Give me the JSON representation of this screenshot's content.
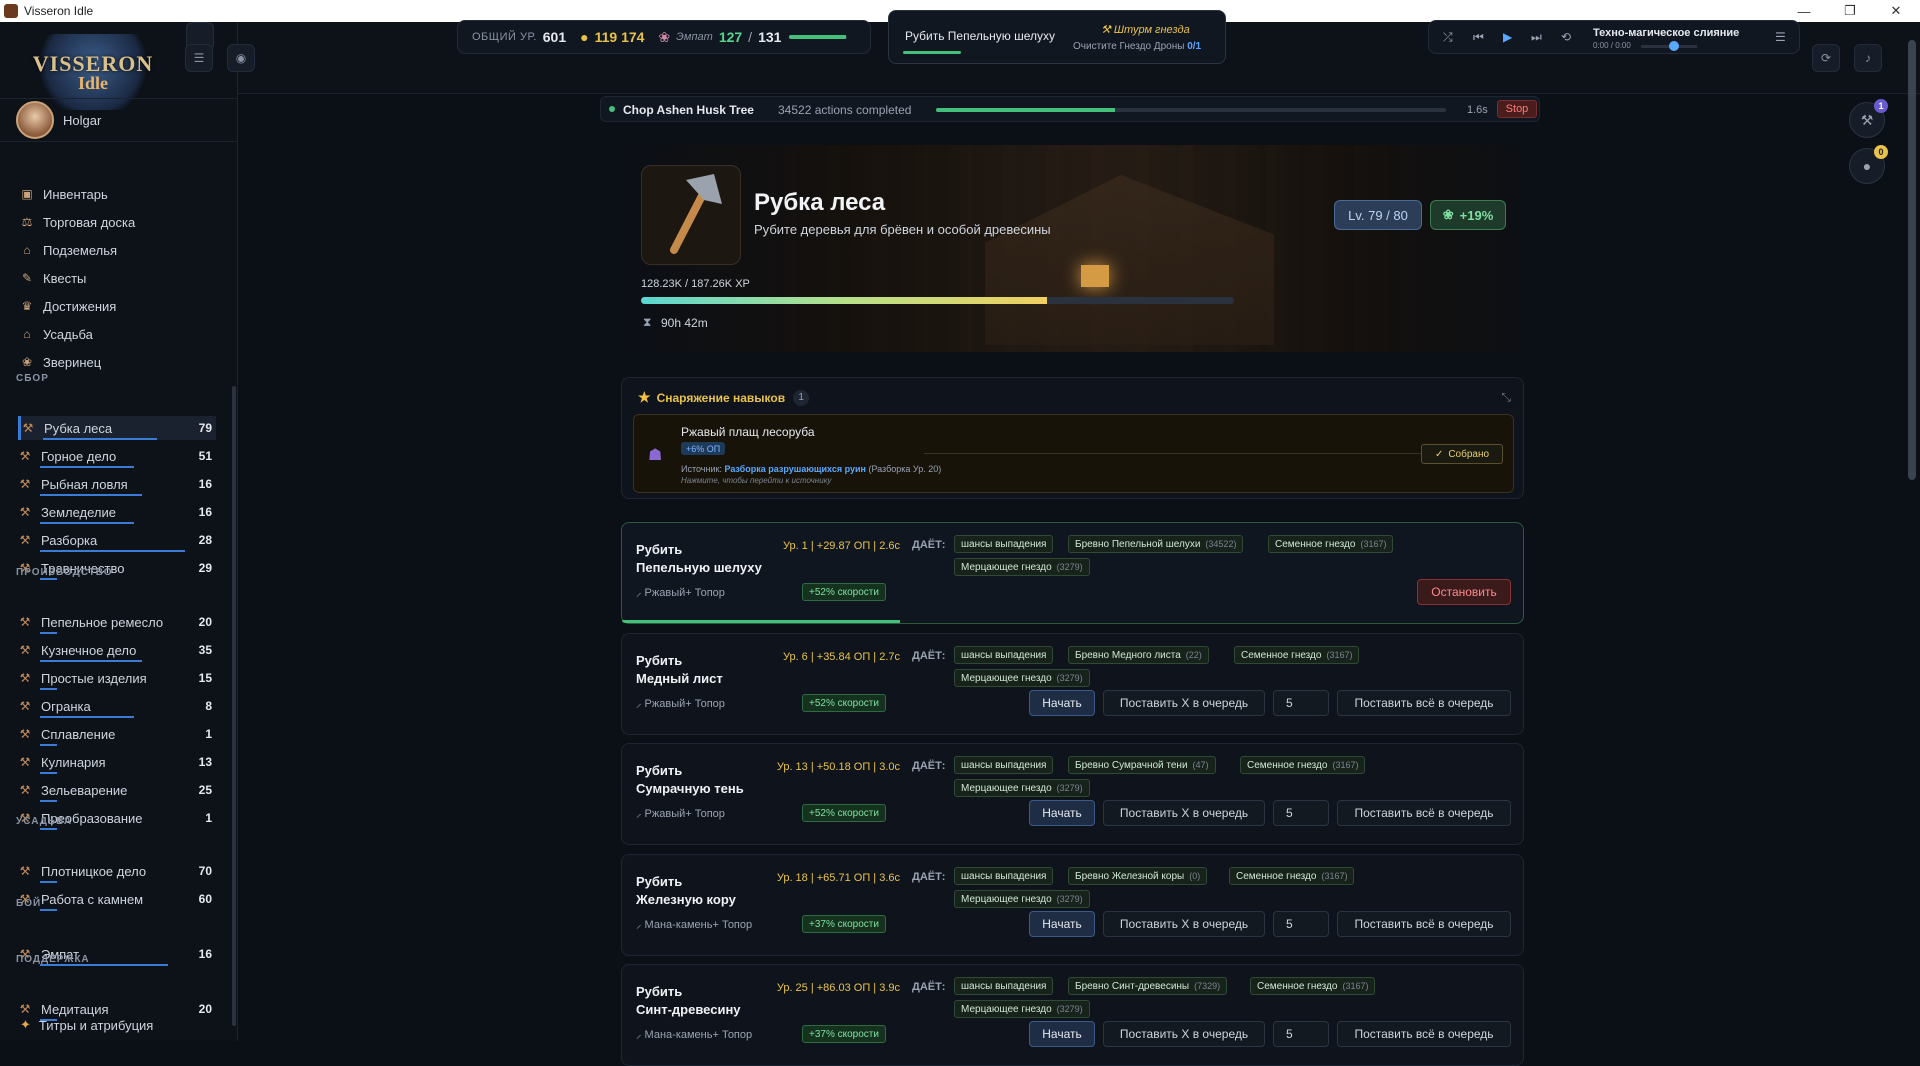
{
  "window": {
    "title": "Visseron Idle",
    "min": "—",
    "max": "❐",
    "close": "✕"
  },
  "logo": {
    "line1": "VISSERON",
    "line2": "Idle"
  },
  "user": {
    "name": "Holgar"
  },
  "nav": [
    {
      "label": "Инвентарь",
      "icon": "backpack-icon",
      "glyph": "▣"
    },
    {
      "label": "Торговая доска",
      "icon": "scale-icon",
      "glyph": "⚖"
    },
    {
      "label": "Подземелья",
      "icon": "dungeon-icon",
      "glyph": "⌂"
    },
    {
      "label": "Квесты",
      "icon": "scroll-icon",
      "glyph": "✎"
    },
    {
      "label": "Достижения",
      "icon": "trophy-icon",
      "glyph": "♛"
    },
    {
      "label": "Усадьба",
      "icon": "house-icon",
      "glyph": "⌂"
    },
    {
      "label": "Зверинец",
      "icon": "paw-icon",
      "glyph": "❀"
    }
  ],
  "sections": {
    "gather": "СБОР",
    "produce": "ПРОИЗВОДСТВО",
    "manor": "УСАДЬБА",
    "combat": "БОЙ",
    "support": "ПОДДЕРЖКА"
  },
  "skills_gather": [
    {
      "label": "Рубка леса",
      "lv": "79",
      "progress": 0.67
    },
    {
      "label": "Горное дело",
      "lv": "51",
      "progress": 0.55
    },
    {
      "label": "Рыбная ловля",
      "lv": "16",
      "progress": 0.6
    },
    {
      "label": "Земледелие",
      "lv": "16",
      "progress": 0.55
    },
    {
      "label": "Разборка",
      "lv": "28",
      "progress": 0.85
    },
    {
      "label": "Травничество",
      "lv": "29",
      "progress": 0.1
    }
  ],
  "skills_produce": [
    {
      "label": "Пепельное ремесло",
      "lv": "20",
      "progress": 0.1
    },
    {
      "label": "Кузнечное дело",
      "lv": "35",
      "progress": 0.6
    },
    {
      "label": "Простые изделия",
      "lv": "15",
      "progress": 0.1
    },
    {
      "label": "Огранка",
      "lv": "8",
      "progress": 0.55
    },
    {
      "label": "Сплавление",
      "lv": "1",
      "progress": 0.1
    },
    {
      "label": "Кулинария",
      "lv": "13",
      "progress": 0.1
    },
    {
      "label": "Зельеварение",
      "lv": "25",
      "progress": 0.1
    },
    {
      "label": "Преобразование",
      "lv": "1",
      "progress": 0.1
    }
  ],
  "skills_manor": [
    {
      "label": "Плотницкое дело",
      "lv": "70",
      "progress": 0.1
    },
    {
      "label": "Работа с камнем",
      "lv": "60",
      "progress": 0.1
    }
  ],
  "skills_combat": [
    {
      "label": "Эмпат",
      "lv": "16",
      "progress": 0.75
    }
  ],
  "skills_support": [
    {
      "label": "Медитация",
      "lv": "20",
      "progress": 0.1
    }
  ],
  "footer": {
    "label": "Титры и атрибуция"
  },
  "stats": {
    "total_label": "ОБЩИЙ УР.",
    "total": "601",
    "gold": "119 174",
    "empath_label": "Эмпат",
    "empath_cur": "127",
    "sep": "/",
    "empath_max": "131",
    "empath_progress": 0.97
  },
  "current": {
    "action": "Рубить Пепельную шелуху",
    "quest": "Штурм гнезда",
    "quest_task": "Очистите Гнездо Дроны",
    "quest_count": "0/1"
  },
  "player": {
    "track": "Техно-магическое слияние",
    "time": "0:00 / 0:00",
    "volume": 0.5
  },
  "status": {
    "name": "Chop Ashen Husk Tree",
    "count": "34522 actions completed",
    "progress": 0.35,
    "time": "1.6s",
    "stop": "Stop"
  },
  "right_badges": {
    "b1": "1",
    "b2": "0"
  },
  "hero": {
    "title": "Рубка леса",
    "subtitle": "Рубите деревья для брёвен и особой древесины",
    "level": "Lv. 79 / 80",
    "bonus": "+19%",
    "xp": "128.23K / 187.26K XP",
    "xp_progress": 0.685,
    "time": "90h 42m"
  },
  "gear": {
    "title": "Снаряжение навыков",
    "count": "1",
    "item": "Ржавый плащ лесоруба",
    "tag": "+6% ОП",
    "source_label": "Источник:",
    "source_link": "Разборка разрушающихся руин",
    "source_extra": "(Разборка Ур. 20)",
    "hint": "Нажмите, чтобы перейти к источнику",
    "collected": "Собрано"
  },
  "gives_label": "ДАЁТ:",
  "drop_chance": "шансы выпадения",
  "btn": {
    "start": "Начать",
    "queue_x": "Поставить X в очередь",
    "queue_all": "Поставить всё в очередь",
    "stop": "Остановить",
    "qty": "5"
  },
  "actions": [
    {
      "name": "Рубить\nПепельную шелуху",
      "meta": "Ур. 1 | +29.87 ОП | 2.6с",
      "tool": "Ржавый+ Топор",
      "speed": "+52% скорости",
      "log": "Бревно Пепельной шелухи",
      "log_n": "(34522)",
      "seed": "Семенное гнездо",
      "seed_n": "(3167)",
      "nest": "Мерцающее гнездо",
      "nest_n": "(3279)",
      "active": true,
      "progress": 0.35
    },
    {
      "name": "Рубить\nМедный лист",
      "meta": "Ур. 6 | +35.84 ОП | 2.7с",
      "tool": "Ржавый+ Топор",
      "speed": "+52% скорости",
      "log": "Бревно Медного листа",
      "log_n": "(22)",
      "seed": "Семенное гнездо",
      "seed_n": "(3167)",
      "nest": "Мерцающее гнездо",
      "nest_n": "(3279)"
    },
    {
      "name": "Рубить\nСумрачную тень",
      "meta": "Ур. 13 | +50.18 ОП | 3.0с",
      "tool": "Ржавый+ Топор",
      "speed": "+52% скорости",
      "log": "Бревно Сумрачной тени",
      "log_n": "(47)",
      "seed": "Семенное гнездо",
      "seed_n": "(3167)",
      "nest": "Мерцающее гнездо",
      "nest_n": "(3279)"
    },
    {
      "name": "Рубить\nЖелезную кору",
      "meta": "Ур. 18 | +65.71 ОП | 3.6с",
      "tool": "Мана-камень+ Топор",
      "speed": "+37% скорости",
      "log": "Бревно Железной коры",
      "log_n": "(0)",
      "seed": "Семенное гнездо",
      "seed_n": "(3167)",
      "nest": "Мерцающее гнездо",
      "nest_n": "(3279)"
    },
    {
      "name": "Рубить\nСинт-древесину",
      "meta": "Ур. 25 | +86.03 ОП | 3.9с",
      "tool": "Мана-камень+ Топор",
      "speed": "+37% скорости",
      "log": "Бревно Синт-древесины",
      "log_n": "(7329)",
      "seed": "Семенное гнездо",
      "seed_n": "(3167)",
      "nest": "Мерцающее гнездо",
      "nest_n": "(3279)"
    }
  ]
}
